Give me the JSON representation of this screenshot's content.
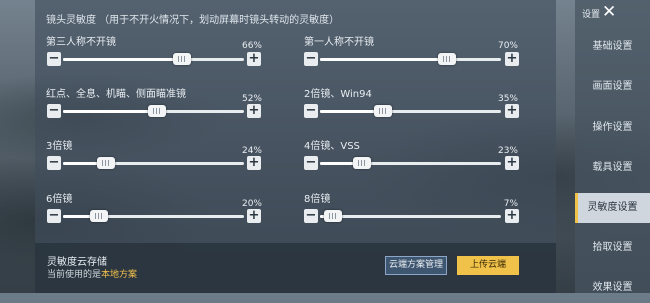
{
  "header": {
    "text": "镜头灵敏度 （用于不开火情况下，划动屏幕时镜头转动的灵敏度）"
  },
  "sliders": [
    {
      "label": "第三人称不开镜",
      "pct": "66%",
      "value": 0.66
    },
    {
      "label": "第一人称不开镜",
      "pct": "70%",
      "value": 0.7
    },
    {
      "label": "红点、全息、机瞄、侧面瞄准镜",
      "pct": "52%",
      "value": 0.52
    },
    {
      "label": "2倍镜、Win94",
      "pct": "35%",
      "value": 0.35
    },
    {
      "label": "3倍镜",
      "pct": "24%",
      "value": 0.24
    },
    {
      "label": "4倍镜、VSS",
      "pct": "23%",
      "value": 0.23
    },
    {
      "label": "6倍镜",
      "pct": "20%",
      "value": 0.2
    },
    {
      "label": "8倍镜",
      "pct": "7%",
      "value": 0.07
    }
  ],
  "buttons": {
    "minus": "−",
    "plus": "+"
  },
  "cloud": {
    "title": "灵敏度云存储",
    "sub_prefix": "当前使用的是",
    "sub_highlight": "本地方案",
    "scheme_button": "云端方案管理",
    "upload_button": "上传云端"
  },
  "sidebar": {
    "title": "设置",
    "close_icon": "✕",
    "items": [
      "基础设置",
      "画面设置",
      "操作设置",
      "载具设置",
      "灵敏度设置",
      "拾取设置",
      "效果设置"
    ],
    "active_index": 4
  },
  "colors": {
    "accent": "#f1c24a",
    "highlight_text": "#f2c04b"
  }
}
